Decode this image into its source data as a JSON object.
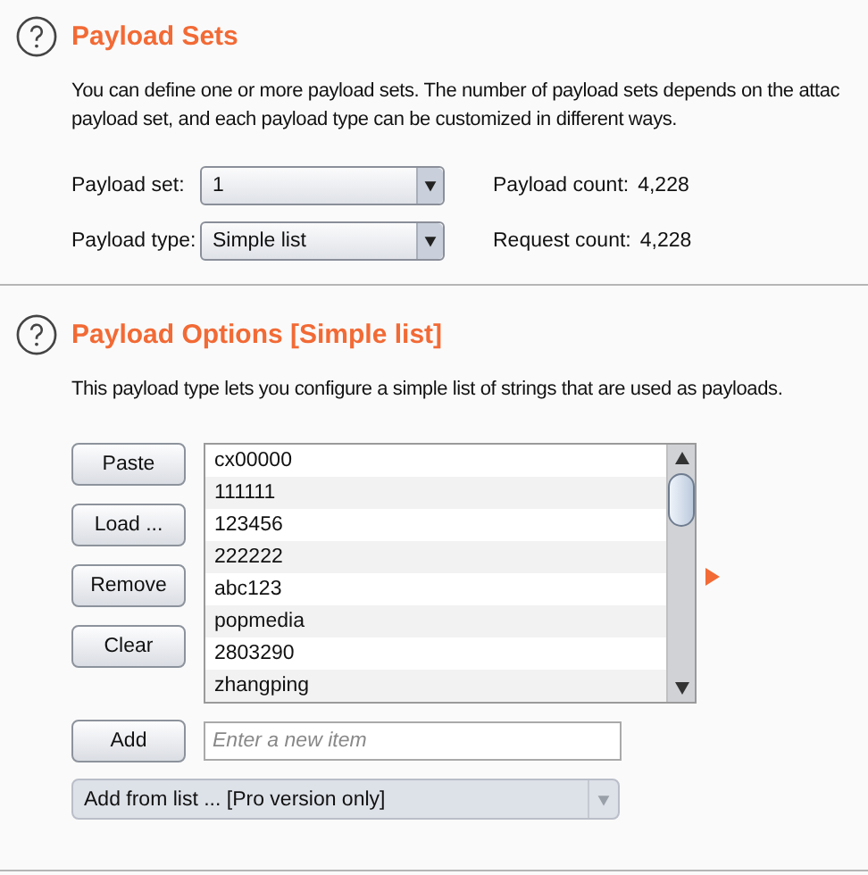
{
  "sections": [
    {
      "title": "Payload Sets",
      "description_lines": [
        "You can define one or more payload sets. The number of payload sets depends on the attac",
        "payload set, and each payload type can be customized in different ways."
      ],
      "fields": [
        {
          "label": "Payload set:",
          "value": "1",
          "count_label": "Payload count:",
          "count": "4,228"
        },
        {
          "label": "Payload type:",
          "value": "Simple list",
          "count_label": "Request count:",
          "count": "4,228"
        }
      ]
    },
    {
      "title": "Payload Options [Simple list]",
      "description_lines": [
        "This payload type lets you configure a simple list of strings that are used as payloads."
      ],
      "buttons": [
        "Paste",
        "Load ...",
        "Remove",
        "Clear"
      ],
      "list_items": [
        "cx00000",
        "111111",
        "123456",
        "222222",
        "abc123",
        "popmedia",
        "2803290",
        "zhangping"
      ],
      "add_button": "Add",
      "add_field": {
        "placeholder": "Enter a new item"
      },
      "add_from_list": {
        "value": "Add from list ... [Pro version only]",
        "disabled": true
      }
    }
  ]
}
